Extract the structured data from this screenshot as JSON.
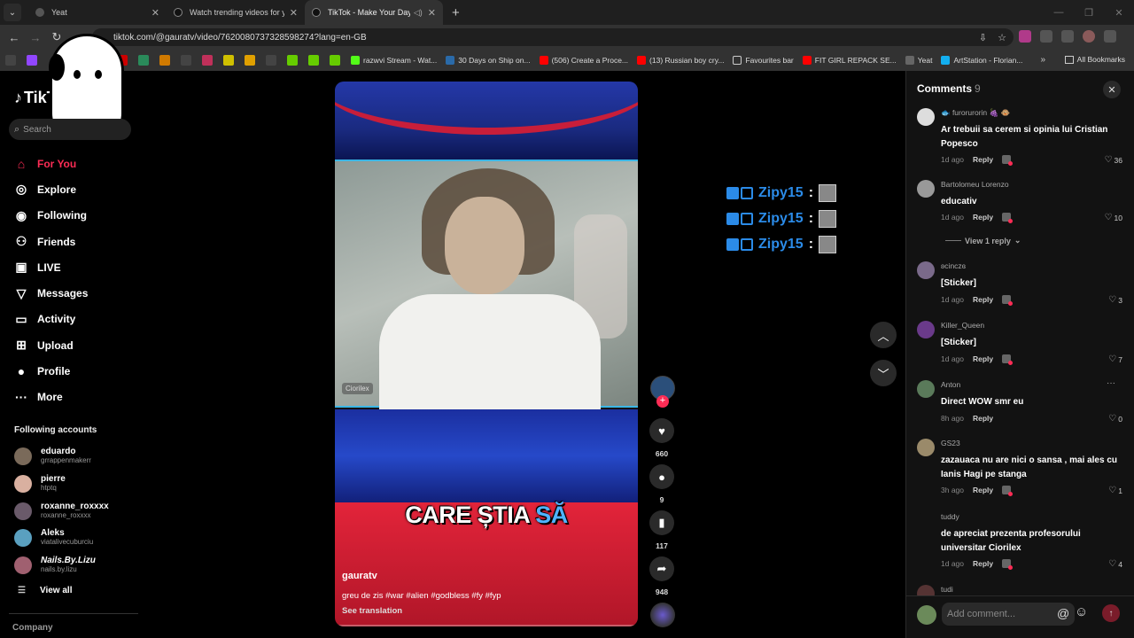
{
  "browser": {
    "tabs": [
      {
        "title": "Yeat",
        "active": false
      },
      {
        "title": "Watch trending videos for you",
        "active": false
      },
      {
        "title": "TikTok - Make Your Day",
        "active": true
      }
    ],
    "url": "tiktok.com/@gauratv/video/7620080737328598274?lang=en-GB",
    "bookmarks": [
      "razwvi Stream - Wat...",
      "30 Days on Ship on...",
      "(506) Create a Proce...",
      "(13) Russian boy cry...",
      "Favourites bar",
      "FIT GIRL REPACK SE...",
      "Yeat",
      "ArtStation - Florian..."
    ],
    "all_bookmarks": "All Bookmarks",
    "colors": {
      "accent": "#fe2c55",
      "link": "#2b8be8"
    }
  },
  "sidebar": {
    "logo": "TikTok",
    "search_placeholder": "Search",
    "menu": [
      {
        "label": "For You",
        "icon": "home-icon"
      },
      {
        "label": "Explore",
        "icon": "compass-icon"
      },
      {
        "label": "Following",
        "icon": "following-icon"
      },
      {
        "label": "Friends",
        "icon": "friends-icon"
      },
      {
        "label": "LIVE",
        "icon": "live-icon"
      },
      {
        "label": "Messages",
        "icon": "messages-icon"
      },
      {
        "label": "Activity",
        "icon": "activity-icon"
      },
      {
        "label": "Upload",
        "icon": "upload-icon"
      },
      {
        "label": "Profile",
        "icon": "profile-icon"
      },
      {
        "label": "More",
        "icon": "more-icon"
      }
    ],
    "following_header": "Following accounts",
    "following": [
      {
        "name": "eduardo",
        "handle": "grrappenmakerr"
      },
      {
        "name": "pierre",
        "handle": "htptq"
      },
      {
        "name": "roxanne_roxxxx",
        "handle": "roxanne_roxxxx"
      },
      {
        "name": "Aleks",
        "handle": "viatalivecuburciu"
      },
      {
        "name": "Nails.By.Lizu",
        "handle": "nails.by.lizu"
      }
    ],
    "view_all": "View all",
    "company": "Company"
  },
  "video": {
    "caption_main": "CARE ȘTIA ",
    "caption_highlight": "SĂ",
    "author": "gauratv",
    "description": "greu de zis #war #alien #godbless #fy #fyp",
    "see_translation": "See translation",
    "watermark": "Ciorilex",
    "likes": "660",
    "comments": "9",
    "saves": "117",
    "shares": "948"
  },
  "overlay": {
    "lines": [
      "Zipy15",
      "Zipy15",
      "Zipy15"
    ],
    "separator": ":"
  },
  "comments_panel": {
    "title": "Comments",
    "count": "9",
    "items": [
      {
        "user": "🐟 furorurorin 🍇 🐵",
        "text": "Ar trebuii sa cerem si opinia lui Cristian Popesco",
        "time": "1d ago",
        "likes": "36"
      },
      {
        "user": "Bartolomeu Lorenzo",
        "text": "educativ",
        "time": "1d ago",
        "likes": "10"
      },
      {
        "user": "ʚcinczɞ",
        "text": "[Sticker]",
        "time": "1d ago",
        "likes": "3"
      },
      {
        "user": "Killer_Queen",
        "text": "[Sticker]",
        "time": "1d ago",
        "likes": "7"
      },
      {
        "user": "Anton",
        "text": "Direct WOW smr eu",
        "time": "8h ago",
        "likes": "0"
      },
      {
        "user": "GS23",
        "text": "zazauaca nu are nici o sansa , mai ales cu Ianis Hagi pe stanga",
        "time": "3h ago",
        "likes": "1"
      },
      {
        "user": "tuddy",
        "text": "de apreciat prezenta profesorului universitar Ciorilex",
        "time": "1d ago",
        "likes": "4"
      },
      {
        "user": "tudi",
        "text": "",
        "time": "",
        "likes": ""
      }
    ],
    "reply_label": "Reply",
    "view_reply": "View 1 reply",
    "input_placeholder": "Add comment..."
  }
}
